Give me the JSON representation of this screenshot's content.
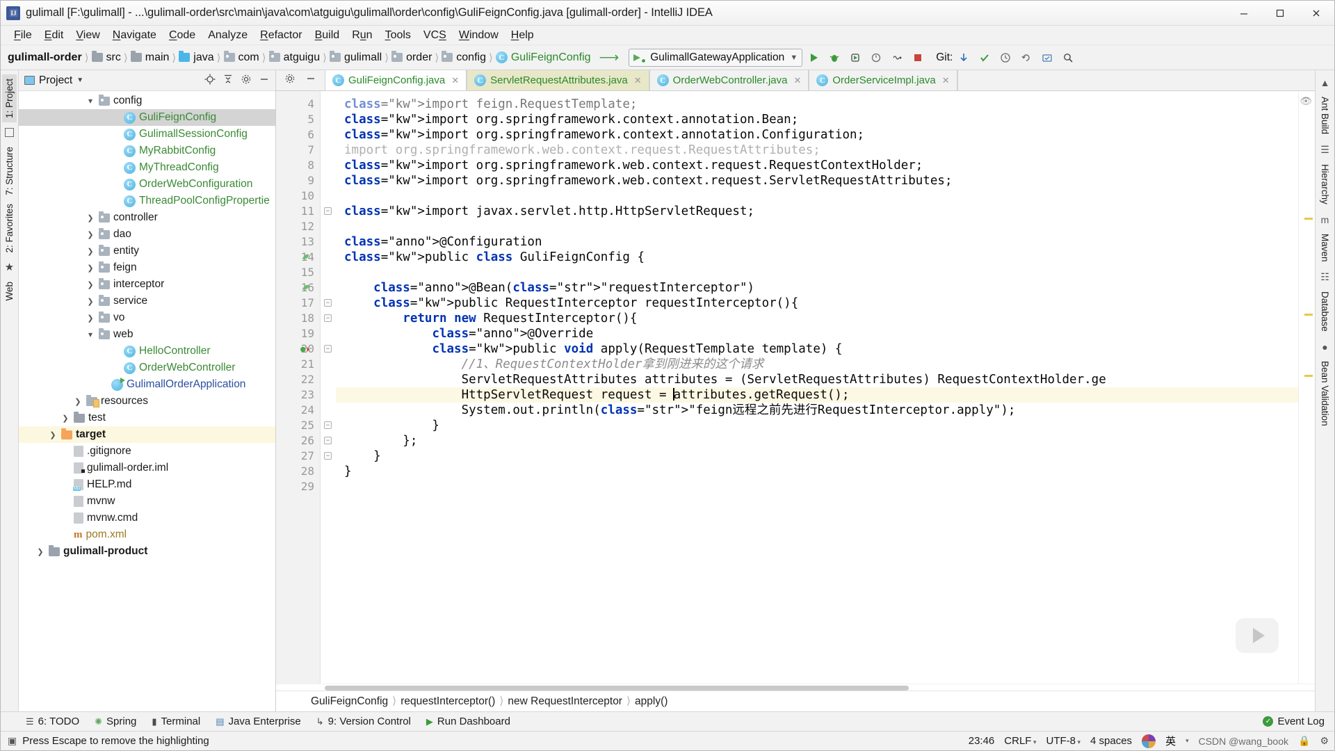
{
  "window": {
    "title": "gulimall [F:\\gulimall] - ...\\gulimall-order\\src\\main\\java\\com\\atguigu\\gulimall\\order\\config\\GuliFeignConfig.java [gulimall-order] - IntelliJ IDEA",
    "logo_letter": "IJ",
    "minimize": "minimize-icon",
    "maximize": "maximize-icon",
    "close": "close-icon"
  },
  "menu": [
    "File",
    "Edit",
    "View",
    "Navigate",
    "Code",
    "Analyze",
    "Refactor",
    "Build",
    "Run",
    "Tools",
    "VCS",
    "Window",
    "Help"
  ],
  "navbar": {
    "crumbs": [
      {
        "label": "gulimall-order",
        "icon": "none",
        "root": true
      },
      {
        "label": "src",
        "icon": "folder-grey"
      },
      {
        "label": "main",
        "icon": "folder-grey"
      },
      {
        "label": "java",
        "icon": "folder-blue"
      },
      {
        "label": "com",
        "icon": "folder-package"
      },
      {
        "label": "atguigu",
        "icon": "folder-package"
      },
      {
        "label": "gulimall",
        "icon": "folder-package"
      },
      {
        "label": "order",
        "icon": "folder-package"
      },
      {
        "label": "config",
        "icon": "folder-package"
      },
      {
        "label": "GuliFeignConfig",
        "icon": "class"
      }
    ],
    "run_config": "GulimallGatewayApplication",
    "git_label": "Git:",
    "buttons": [
      "run-button",
      "debug-button",
      "run-with-coverage-button",
      "profile-button",
      "attach-button",
      "stop-button"
    ],
    "git_buttons": [
      "update-project-button",
      "commit-button",
      "history-button",
      "rollback-button"
    ],
    "right_buttons": [
      "search-everywhere-button",
      "settings-button",
      "select-opened-file-button"
    ]
  },
  "left_rail": [
    {
      "label": "1: Project",
      "selected": true
    },
    {
      "label": "7: Structure",
      "selected": false
    },
    {
      "label": "2: Favorites",
      "selected": false
    },
    {
      "label": "Web",
      "selected": false
    }
  ],
  "right_rail": [
    {
      "label": "Ant Build"
    },
    {
      "label": "Hierarchy"
    },
    {
      "label": "Maven"
    },
    {
      "label": "Database"
    },
    {
      "label": "Bean Validation"
    }
  ],
  "project_panel": {
    "title": "Project",
    "icons": [
      "locate-icon",
      "collapse-all-icon",
      "settings-icon",
      "hide-icon"
    ],
    "tree": [
      {
        "label": "config",
        "indent": 5,
        "caret": "down",
        "icon": "folder-package",
        "style": "plain",
        "state": "normal"
      },
      {
        "label": "GuliFeignConfig",
        "indent": 7,
        "caret": "none",
        "icon": "class",
        "style": "green",
        "state": "selected"
      },
      {
        "label": "GulimallSessionConfig",
        "indent": 7,
        "caret": "none",
        "icon": "class",
        "style": "green",
        "state": "normal"
      },
      {
        "label": "MyRabbitConfig",
        "indent": 7,
        "caret": "none",
        "icon": "class",
        "style": "green",
        "state": "normal"
      },
      {
        "label": "MyThreadConfig",
        "indent": 7,
        "caret": "none",
        "icon": "class",
        "style": "green",
        "state": "normal"
      },
      {
        "label": "OrderWebConfiguration",
        "indent": 7,
        "caret": "none",
        "icon": "class",
        "style": "green",
        "state": "normal"
      },
      {
        "label": "ThreadPoolConfigPropertie",
        "indent": 7,
        "caret": "none",
        "icon": "class",
        "style": "green",
        "state": "normal"
      },
      {
        "label": "controller",
        "indent": 5,
        "caret": "right",
        "icon": "folder-package",
        "style": "plain",
        "state": "normal"
      },
      {
        "label": "dao",
        "indent": 5,
        "caret": "right",
        "icon": "folder-package",
        "style": "plain",
        "state": "normal"
      },
      {
        "label": "entity",
        "indent": 5,
        "caret": "right",
        "icon": "folder-package",
        "style": "plain",
        "state": "normal"
      },
      {
        "label": "feign",
        "indent": 5,
        "caret": "right",
        "icon": "folder-package",
        "style": "plain",
        "state": "normal"
      },
      {
        "label": "interceptor",
        "indent": 5,
        "caret": "right",
        "icon": "folder-package",
        "style": "plain",
        "state": "normal"
      },
      {
        "label": "service",
        "indent": 5,
        "caret": "right",
        "icon": "folder-package",
        "style": "plain",
        "state": "normal"
      },
      {
        "label": "vo",
        "indent": 5,
        "caret": "right",
        "icon": "folder-package",
        "style": "plain",
        "state": "normal"
      },
      {
        "label": "web",
        "indent": 5,
        "caret": "down",
        "icon": "folder-package",
        "style": "plain",
        "state": "normal"
      },
      {
        "label": "HelloController",
        "indent": 7,
        "caret": "none",
        "icon": "class",
        "style": "green",
        "state": "normal"
      },
      {
        "label": "OrderWebController",
        "indent": 7,
        "caret": "none",
        "icon": "class",
        "style": "green",
        "state": "normal"
      },
      {
        "label": "GulimallOrderApplication",
        "indent": 6,
        "caret": "none",
        "icon": "app",
        "style": "blue",
        "state": "normal"
      },
      {
        "label": "resources",
        "indent": 4,
        "caret": "right",
        "icon": "resources",
        "style": "plain",
        "state": "normal"
      },
      {
        "label": "test",
        "indent": 3,
        "caret": "right",
        "icon": "folder-grey",
        "style": "plain",
        "state": "normal"
      },
      {
        "label": "target",
        "indent": 2,
        "caret": "right",
        "icon": "folder-orange",
        "style": "bold",
        "state": "highlighted"
      },
      {
        "label": ".gitignore",
        "indent": 3,
        "caret": "none",
        "icon": "file",
        "style": "plain",
        "state": "normal"
      },
      {
        "label": "gulimall-order.iml",
        "indent": 3,
        "caret": "none",
        "icon": "file-iml",
        "style": "plain",
        "state": "normal"
      },
      {
        "label": "HELP.md",
        "indent": 3,
        "caret": "none",
        "icon": "file-md",
        "style": "plain",
        "state": "normal"
      },
      {
        "label": "mvnw",
        "indent": 3,
        "caret": "none",
        "icon": "file",
        "style": "plain",
        "state": "normal"
      },
      {
        "label": "mvnw.cmd",
        "indent": 3,
        "caret": "none",
        "icon": "file",
        "style": "plain",
        "state": "normal"
      },
      {
        "label": "pom.xml",
        "indent": 3,
        "caret": "none",
        "icon": "maven",
        "style": "yellowish",
        "state": "normal"
      },
      {
        "label": "gulimall-product",
        "indent": 1,
        "caret": "right",
        "icon": "folder-grey",
        "style": "bold",
        "state": "normal"
      }
    ]
  },
  "editor": {
    "tabs": [
      {
        "label": "GuliFeignConfig.java",
        "state": "active"
      },
      {
        "label": "ServletRequestAttributes.java",
        "state": "highlighted"
      },
      {
        "label": "OrderWebController.java",
        "state": "normal"
      },
      {
        "label": "OrderServiceImpl.java",
        "state": "normal"
      }
    ],
    "tab_tools": [
      "settings-icon",
      "minimize-icon"
    ],
    "first_visible_line": 4,
    "current_line": 23,
    "lines": [
      {
        "n": 4,
        "text": "import feign.RequestTemplate;",
        "clipped": true
      },
      {
        "n": 5,
        "text": "import org.springframework.context.annotation.Bean;"
      },
      {
        "n": 6,
        "text": "import org.springframework.context.annotation.Configuration;"
      },
      {
        "n": 7,
        "text": "import org.springframework.web.context.request.RequestAttributes;",
        "unused": true
      },
      {
        "n": 8,
        "text": "import org.springframework.web.context.request.RequestContextHolder;"
      },
      {
        "n": 9,
        "text": "import org.springframework.web.context.request.ServletRequestAttributes;"
      },
      {
        "n": 10,
        "text": ""
      },
      {
        "n": 11,
        "text": "import javax.servlet.http.HttpServletRequest;"
      },
      {
        "n": 12,
        "text": ""
      },
      {
        "n": 13,
        "text": "@Configuration"
      },
      {
        "n": 14,
        "text": "public class GuliFeignConfig {"
      },
      {
        "n": 15,
        "text": ""
      },
      {
        "n": 16,
        "text": "    @Bean(\"requestInterceptor\")"
      },
      {
        "n": 17,
        "text": "    public RequestInterceptor requestInterceptor(){"
      },
      {
        "n": 18,
        "text": "        return new RequestInterceptor(){"
      },
      {
        "n": 19,
        "text": "            @Override"
      },
      {
        "n": 20,
        "text": "            public void apply(RequestTemplate template) {"
      },
      {
        "n": 21,
        "text": "                //1、RequestContextHolder拿到刚进来的这个请求"
      },
      {
        "n": 22,
        "text": "                ServletRequestAttributes attributes = (ServletRequestAttributes) RequestContextHolder.ge"
      },
      {
        "n": 23,
        "text": "                HttpServletRequest request = attributes.getRequest();"
      },
      {
        "n": 24,
        "text": "                System.out.println(\"feign远程之前先进行RequestInterceptor.apply\");"
      },
      {
        "n": 25,
        "text": "            }"
      },
      {
        "n": 26,
        "text": "        };"
      },
      {
        "n": 27,
        "text": "    }"
      },
      {
        "n": 28,
        "text": "}"
      },
      {
        "n": 29,
        "text": ""
      }
    ],
    "bottom_breadcrumb": [
      "GuliFeignConfig",
      "requestInterceptor()",
      "new RequestInterceptor",
      "apply()"
    ]
  },
  "bottom_toolwindows": [
    {
      "label": "6: TODO",
      "icon": "list-icon"
    },
    {
      "label": "Spring",
      "icon": "spring-leaf-icon"
    },
    {
      "label": "Terminal",
      "icon": "terminal-icon"
    },
    {
      "label": "Java Enterprise",
      "icon": "java-ee-icon"
    },
    {
      "label": "9: Version Control",
      "icon": "branch-icon"
    },
    {
      "label": "Run Dashboard",
      "icon": "run-icon"
    }
  ],
  "event_log": {
    "label": "Event Log",
    "icon": "event-log-icon"
  },
  "statusbar": {
    "message": "Press Escape to remove the highlighting",
    "message_icon": "info-icon",
    "time": "23:46",
    "line_separator": "CRLF",
    "encoding": "UTF-8",
    "indent": "4 spaces",
    "ime_lang": "英",
    "ime_book": "wang_book",
    "watermark": "CSDN @wang_book",
    "lock_icon": "lock-icon",
    "hint_icon": "hint-icon"
  },
  "colors": {
    "accent_green": "#2a8a2a",
    "keyword_blue": "#0033b3",
    "string_green": "#067d17",
    "annotation_gold": "#9e880d",
    "comment_grey": "#8c8c8c",
    "highlight_yellow": "#f5e400",
    "selection_grey": "#d4d4d4",
    "current_line": "#fdf8e3"
  }
}
